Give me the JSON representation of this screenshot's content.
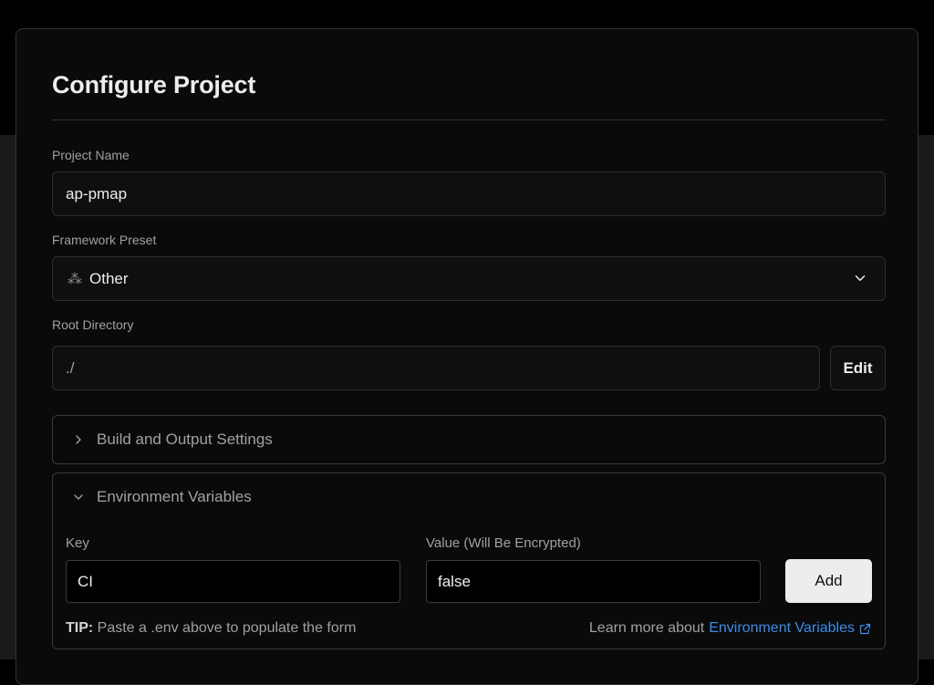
{
  "title": "Configure Project",
  "project_name": {
    "label": "Project Name",
    "value": "ap-pmap"
  },
  "framework": {
    "label": "Framework Preset",
    "icon": "triangle-dots-icon",
    "value": "Other"
  },
  "root_directory": {
    "label": "Root Directory",
    "value": "./",
    "edit_label": "Edit"
  },
  "build_section": {
    "label": "Build and Output Settings",
    "expanded": false
  },
  "env_section": {
    "label": "Environment Variables",
    "expanded": true,
    "key_label": "Key",
    "key_value": "CI",
    "value_label": "Value (Will Be Encrypted)",
    "value_value": "false",
    "add_label": "Add",
    "tip_strong": "TIP:",
    "tip_text": " Paste a .env above to populate the form",
    "learn_text": "Learn more about",
    "learn_link": "Environment Variables"
  },
  "colors": {
    "background": "#000000",
    "card": "#0a0a0a",
    "link": "#3b8eea",
    "button": "#ededed"
  }
}
